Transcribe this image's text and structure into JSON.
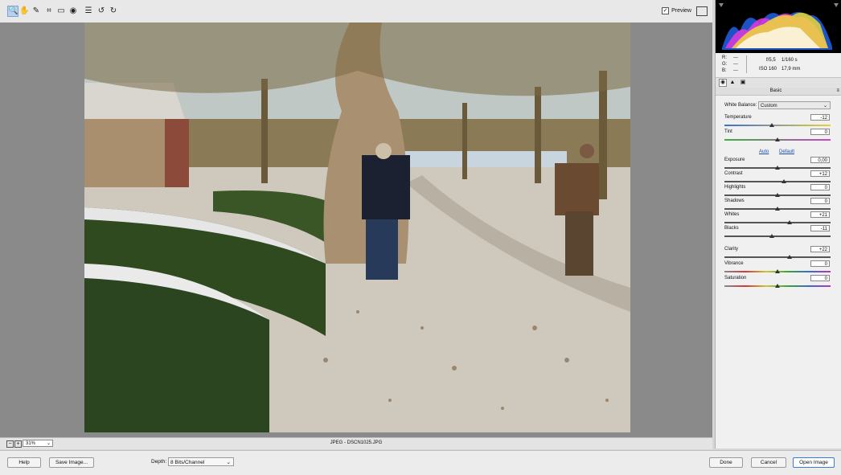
{
  "toolbar": {
    "tools": [
      {
        "icon": "zoom-icon",
        "glyph": "🔍"
      },
      {
        "icon": "hand-icon",
        "glyph": "✋"
      },
      {
        "icon": "eyedropper-icon",
        "glyph": "✎"
      },
      {
        "icon": "crop-icon",
        "glyph": "⌗"
      },
      {
        "icon": "straighten-icon",
        "glyph": "▭"
      },
      {
        "icon": "redeye-icon",
        "glyph": "◉"
      },
      {
        "icon": "list-icon",
        "glyph": "☰"
      },
      {
        "icon": "rotate-left-icon",
        "glyph": "↺"
      },
      {
        "icon": "rotate-right-icon",
        "glyph": "↻"
      }
    ],
    "preview_label": "Preview",
    "preview_checked": true
  },
  "status": {
    "zoom_value": "31%",
    "file_info": "JPEG  -  DSCN1025.JPG"
  },
  "bottom": {
    "help_label": "Help",
    "save_label": "Save Image...",
    "depth_label": "Depth:",
    "depth_value": "8 Bits/Channel",
    "done_label": "Done",
    "cancel_label": "Cancel",
    "open_label": "Open Image"
  },
  "info": {
    "r_label": "R:",
    "r_value": "---",
    "g_label": "G:",
    "g_value": "---",
    "b_label": "B:",
    "b_value": "---",
    "aperture": "f/5,5",
    "shutter": "1/160 s",
    "iso": "ISO 160",
    "focal": "17,9 mm"
  },
  "panel": {
    "title": "Basic",
    "wb_label": "White Balance:",
    "wb_value": "Custom",
    "auto_label": "Auto",
    "default_label": "Default",
    "sliders": [
      {
        "label": "Temperature",
        "value": "-12",
        "level": 0.45
      },
      {
        "label": "Tint",
        "value": "0",
        "level": 0.5
      },
      {
        "label": "Exposure",
        "value": "0,00",
        "level": 0.5
      },
      {
        "label": "Contrast",
        "value": "+12",
        "level": 0.56
      },
      {
        "label": "Highlights",
        "value": "0",
        "level": 0.5
      },
      {
        "label": "Shadows",
        "value": "0",
        "level": 0.5
      },
      {
        "label": "Whites",
        "value": "+21",
        "level": 0.61
      },
      {
        "label": "Blacks",
        "value": "-11",
        "level": 0.45
      },
      {
        "label": "Clarity",
        "value": "+22",
        "level": 0.61
      },
      {
        "label": "Vibrance",
        "value": "0",
        "level": 0.5
      },
      {
        "label": "Saturation",
        "value": "0",
        "level": 0.5
      }
    ]
  }
}
